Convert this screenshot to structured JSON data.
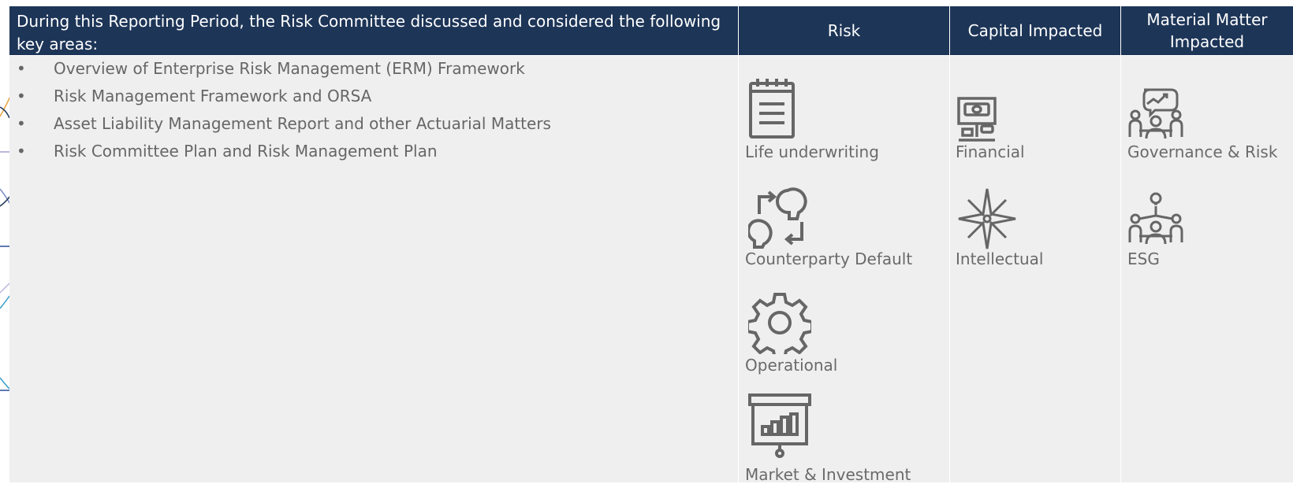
{
  "table": {
    "intro_heading": "During this Reporting Period, the Risk Committee discussed and considered the following key areas:",
    "risk_heading": "Risk",
    "capital_heading": "Capital Impacted",
    "material_heading": "Material Matter Impacted",
    "bullet_glyph": "•",
    "key_areas": [
      "Overview of Enterprise Risk Management (ERM) Framework",
      "Risk Management Framework and ORSA",
      "Asset Liability Management Report and other Actuarial Matters",
      "Risk Committee Plan and Risk Management Plan"
    ],
    "risks": [
      {
        "label": "Life underwriting",
        "icon": "notepad-icon"
      },
      {
        "label": "Counterparty Default",
        "icon": "exchange-heads-icon"
      },
      {
        "label": "Operational",
        "icon": "gear-icon"
      },
      {
        "label": "Market & Investment",
        "icon": "presentation-chart-icon"
      }
    ],
    "capitals": [
      {
        "label": "Financial",
        "icon": "atm-money-icon"
      },
      {
        "label": "Intellectual",
        "icon": "compass-star-icon"
      }
    ],
    "material_matters": [
      {
        "label": "Governance & Risk",
        "icon": "meeting-chart-icon"
      },
      {
        "label": "ESG",
        "icon": "meeting-idea-icon"
      }
    ],
    "colors": {
      "header_bg": "#1d3557",
      "header_text": "#ffffff",
      "body_bg": "#efefef",
      "text": "#666666",
      "icon": "#666666"
    }
  }
}
